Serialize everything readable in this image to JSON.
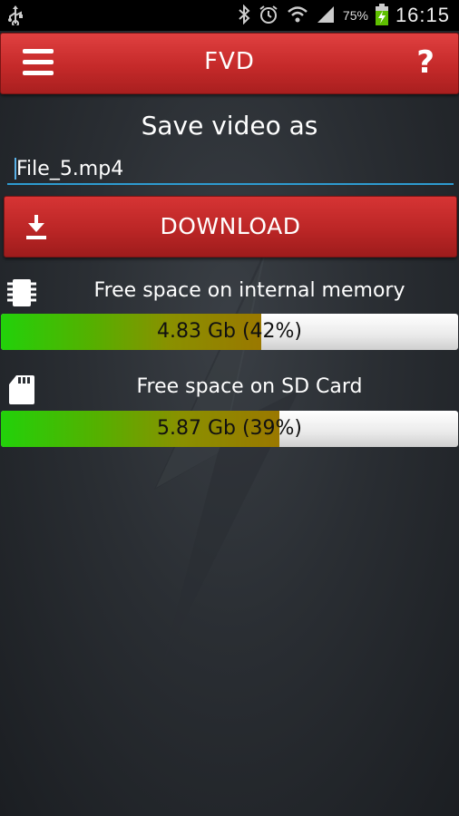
{
  "status_bar": {
    "battery_percent": "75%",
    "time": "16:15"
  },
  "app_bar": {
    "title": "FVD",
    "help_label": "?"
  },
  "save": {
    "label": "Save video as",
    "filename": "File_5.mp4"
  },
  "download": {
    "label": "DOWNLOAD"
  },
  "storage": [
    {
      "caption": "Free space on internal memory",
      "value_text": "4.83 Gb (42%)",
      "fill_percent": 57
    },
    {
      "caption": "Free space on SD Card",
      "value_text": "5.87 Gb (39%)",
      "fill_percent": 61
    }
  ],
  "colors": {
    "accent_red": "#c52a2a",
    "input_underline": "#2e9bd0",
    "bar_green": "#22d10a"
  },
  "icons": {
    "usb": "usb-icon",
    "bluetooth": "bluetooth-icon",
    "alarm": "alarm-icon",
    "wifi": "wifi-icon",
    "signal": "signal-icon",
    "battery": "battery-charging-icon",
    "menu": "hamburger-menu-icon",
    "download": "download-icon",
    "internal_memory": "memory-chip-icon",
    "sd_card": "sd-card-icon"
  }
}
